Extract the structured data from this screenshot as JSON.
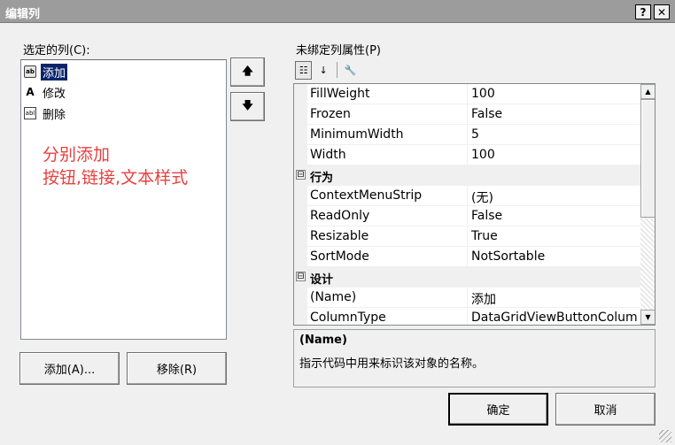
{
  "window": {
    "title": "编辑列",
    "help_label": "?",
    "close_label": "✕"
  },
  "left": {
    "selected_columns_label": "选定的列(C):",
    "columns": [
      {
        "icon": "button-column-icon",
        "label": "添加",
        "selected": true
      },
      {
        "icon": "link-column-icon",
        "label": "修改",
        "selected": false
      },
      {
        "icon": "text-column-icon",
        "label": "删除",
        "selected": false
      }
    ],
    "annotation_line1": "分别添加",
    "annotation_line2": "按钮,链接,文本样式",
    "move_up_label": "🡅",
    "move_down_label": "🡇",
    "add_button_label": "添加(A)...",
    "remove_button_label": "移除(R)"
  },
  "right": {
    "properties_label": "未绑定列属性(P)",
    "toolbar": {
      "categorized": "☷",
      "alphabetical": "↓",
      "property_pages": "🔧"
    },
    "properties": [
      {
        "type": "prop",
        "name": "FillWeight",
        "value": "100"
      },
      {
        "type": "prop",
        "name": "Frozen",
        "value": "False"
      },
      {
        "type": "prop",
        "name": "MinimumWidth",
        "value": "5"
      },
      {
        "type": "prop",
        "name": "Width",
        "value": "100"
      },
      {
        "type": "category",
        "name": "行为",
        "toggle": "⊟"
      },
      {
        "type": "prop",
        "name": "ContextMenuStrip",
        "value": "(无)"
      },
      {
        "type": "prop",
        "name": "ReadOnly",
        "value": "False"
      },
      {
        "type": "prop",
        "name": "Resizable",
        "value": "True"
      },
      {
        "type": "prop",
        "name": "SortMode",
        "value": "NotSortable"
      },
      {
        "type": "category",
        "name": "设计",
        "toggle": "⊟"
      },
      {
        "type": "prop",
        "name": "(Name)",
        "value": "添加"
      },
      {
        "type": "prop",
        "name": "ColumnType",
        "value": "DataGridViewButtonColum"
      }
    ],
    "description_title": "(Name)",
    "description_text": "指示代码中用来标识该对象的名称。"
  },
  "footer": {
    "ok_label": "确定",
    "cancel_label": "取消"
  },
  "colors": {
    "titlebar": "#9c9c9c",
    "selection": "#0a246a",
    "annotation": "#e84040"
  }
}
